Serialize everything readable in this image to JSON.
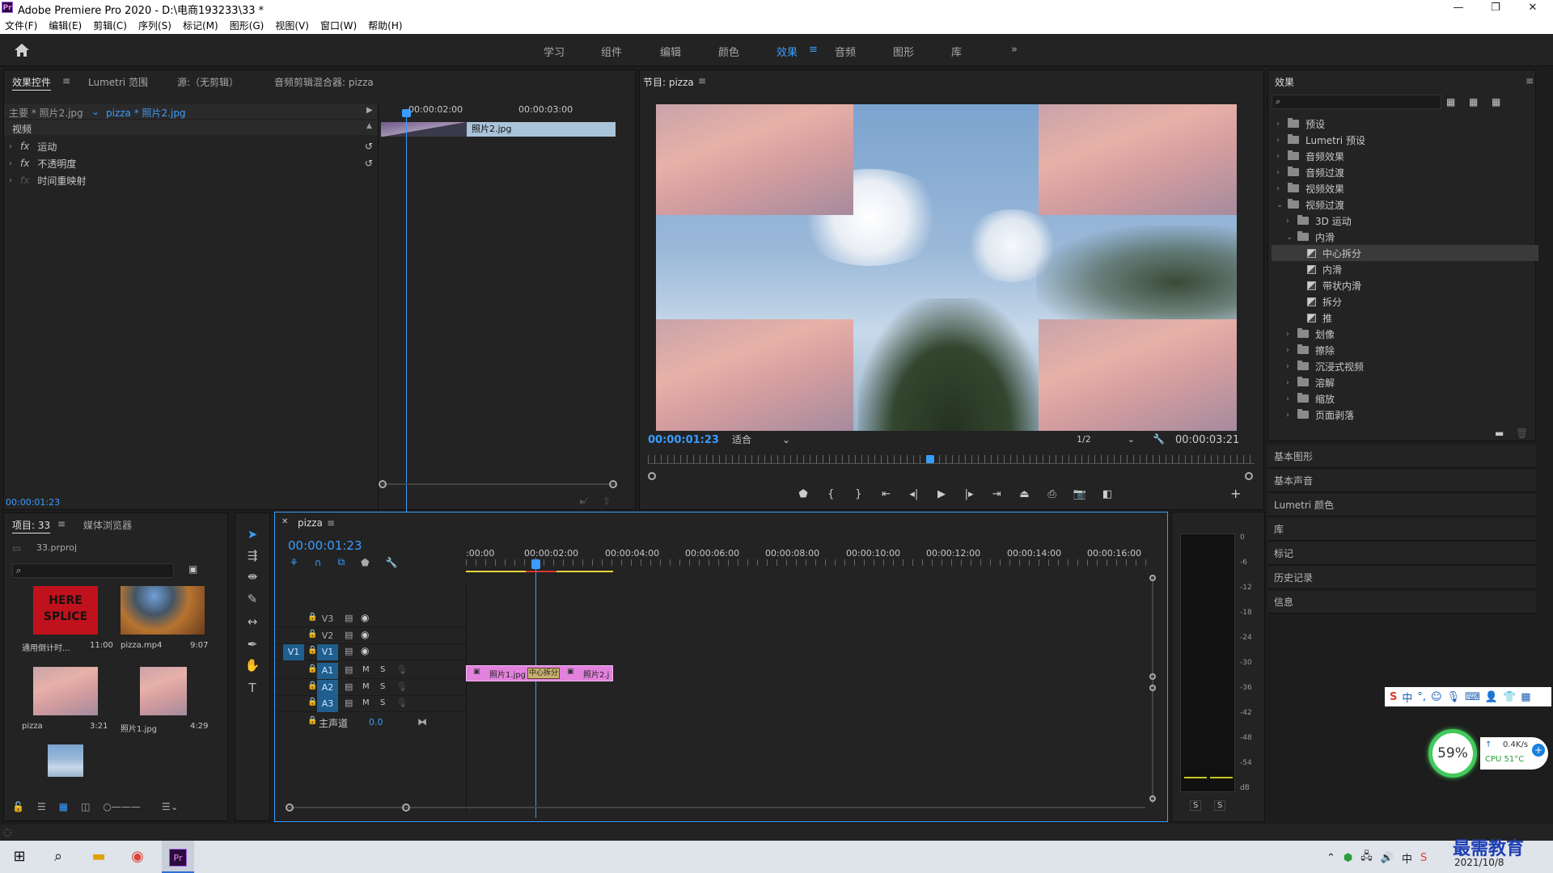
{
  "window": {
    "title": "Adobe Premiere Pro 2020 - D:\\电商193233\\33 *",
    "app_icon": "Pr"
  },
  "menu": [
    "文件(F)",
    "编辑(E)",
    "剪辑(C)",
    "序列(S)",
    "标记(M)",
    "图形(G)",
    "视图(V)",
    "窗口(W)",
    "帮助(H)"
  ],
  "workspaces": {
    "items": [
      "学习",
      "组件",
      "编辑",
      "颜色",
      "效果",
      "音频",
      "图形",
      "库"
    ],
    "active": "效果"
  },
  "effect_controls": {
    "tabs": [
      "效果控件",
      "Lumetri 范围",
      "源:（无剪辑）",
      "音频剪辑混合器: pizza"
    ],
    "master": "主要 * 照片2.jpg",
    "clip": "pizza * 照片2.jpg",
    "section": "视频",
    "items": [
      "运动",
      "不透明度",
      "时间重映射"
    ],
    "time_a": "00:00:02:00",
    "time_b": "00:00:03:00",
    "clip_label": "照片2.jpg",
    "timecode": "00:00:01:23"
  },
  "program": {
    "title": "节目: pizza",
    "timecode": "00:00:01:23",
    "fit": "适合",
    "quality": "1/2",
    "duration": "00:00:03:21"
  },
  "effects_panel": {
    "title": "效果",
    "tree": [
      {
        "label": "预设",
        "depth": 0,
        "open": false,
        "type": "folder"
      },
      {
        "label": "Lumetri 预设",
        "depth": 0,
        "open": false,
        "type": "folder"
      },
      {
        "label": "音频效果",
        "depth": 0,
        "open": false,
        "type": "folder"
      },
      {
        "label": "音频过渡",
        "depth": 0,
        "open": false,
        "type": "folder"
      },
      {
        "label": "视频效果",
        "depth": 0,
        "open": false,
        "type": "folder"
      },
      {
        "label": "视频过渡",
        "depth": 0,
        "open": true,
        "type": "folder"
      },
      {
        "label": "3D 运动",
        "depth": 1,
        "open": false,
        "type": "folder"
      },
      {
        "label": "内滑",
        "depth": 1,
        "open": true,
        "type": "folder"
      },
      {
        "label": "中心拆分",
        "depth": 2,
        "type": "fx",
        "selected": true
      },
      {
        "label": "内滑",
        "depth": 2,
        "type": "fx"
      },
      {
        "label": "带状内滑",
        "depth": 2,
        "type": "fx"
      },
      {
        "label": "拆分",
        "depth": 2,
        "type": "fx"
      },
      {
        "label": "推",
        "depth": 2,
        "type": "fx"
      },
      {
        "label": "划像",
        "depth": 1,
        "open": false,
        "type": "folder"
      },
      {
        "label": "擦除",
        "depth": 1,
        "open": false,
        "type": "folder"
      },
      {
        "label": "沉浸式视频",
        "depth": 1,
        "open": false,
        "type": "folder"
      },
      {
        "label": "溶解",
        "depth": 1,
        "open": false,
        "type": "folder"
      },
      {
        "label": "缩放",
        "depth": 1,
        "open": false,
        "type": "folder"
      },
      {
        "label": "页面剥落",
        "depth": 1,
        "open": false,
        "type": "folder"
      }
    ],
    "side_panels": [
      "基本图形",
      "基本声音",
      "Lumetri 颜色",
      "库",
      "标记",
      "历史记录",
      "信息"
    ]
  },
  "project": {
    "tabs": [
      "项目: 33",
      "媒体浏览器"
    ],
    "file": "33.prproj",
    "items": [
      {
        "name": "通用倒计时...",
        "dur": "11:00",
        "thumb": "splice"
      },
      {
        "name": "pizza.mp4",
        "dur": "9:07",
        "thumb": "pizza"
      },
      {
        "name": "pizza",
        "dur": "3:21",
        "thumb": "sky"
      },
      {
        "name": "照片1.jpg",
        "dur": "4:29",
        "thumb": "sky2"
      },
      {
        "name": "",
        "dur": "",
        "thumb": "blue"
      }
    ],
    "splice_text_1": "HERE",
    "splice_text_2": "SPLICE"
  },
  "timeline": {
    "tab": "pizza",
    "timecode": "00:00:01:23",
    "ruler": [
      ":00:00",
      "00:00:02:00",
      "00:00:04:00",
      "00:00:06:00",
      "00:00:08:00",
      "00:00:10:00",
      "00:00:12:00",
      "00:00:14:00",
      "00:00:16:00"
    ],
    "video_tracks": [
      "V3",
      "V2",
      "V1"
    ],
    "audio_tracks": [
      "A1",
      "A2",
      "A3"
    ],
    "master": "主声道",
    "master_val": "0.0",
    "src_v": "V1",
    "clips": {
      "clip1": "照片1.jpg",
      "transition": "中心拆分",
      "clip2": "照片2.j"
    },
    "m": "M",
    "s": "S"
  },
  "meter": {
    "ticks": [
      "0",
      "-6",
      "-12",
      "-18",
      "-24",
      "-30",
      "-36",
      "-42",
      "-48",
      "-54",
      "dB"
    ],
    "solo": [
      "S",
      "S"
    ]
  },
  "widget": {
    "percent": "59%",
    "net": "0.4K/s",
    "cpu": "CPU 51°C"
  },
  "taskbar": {
    "date": "2021/10/8",
    "watermark": "最需教育"
  }
}
